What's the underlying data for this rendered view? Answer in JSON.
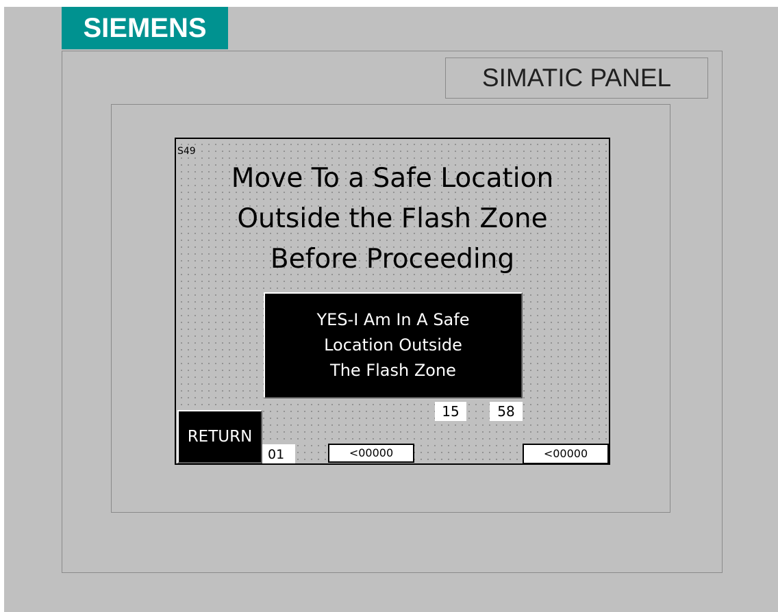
{
  "brand": {
    "logo_text": "SIEMENS",
    "logo_color": "#009290",
    "panel_label": "SIMATIC PANEL"
  },
  "screen": {
    "id": "S49",
    "message_lines": [
      "Move To a Safe Location",
      "Outside the Flash Zone",
      "Before Proceeding"
    ],
    "confirm_button_lines": [
      "YES-I Am In A Safe",
      "Location Outside",
      "The Flash Zone"
    ],
    "return_button": "RETURN",
    "time_hour": "15",
    "time_minute": "58",
    "number_field": "01",
    "value_field_1": "<00000",
    "value_field_2": "<00000"
  },
  "colors": {
    "panel_background": "#c0c0c0",
    "button_background": "#000000",
    "button_text": "#ffffff"
  }
}
